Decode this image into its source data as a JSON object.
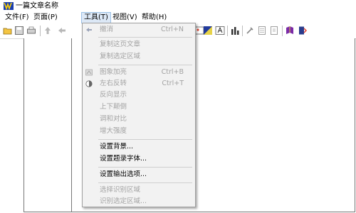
{
  "window": {
    "title": "一篇文章名称"
  },
  "menubar": {
    "items": [
      {
        "label": "文件(F)"
      },
      {
        "label": "页面(P)"
      },
      {
        "label": "工具(T)"
      },
      {
        "label": "视图(V)"
      },
      {
        "label": "帮助(H)"
      }
    ],
    "active": "工具(T)"
  },
  "toolbar": {
    "icons": [
      "open-folder-icon",
      "save-icon",
      "print-icon",
      "up-arrow-icon",
      "back-arrow-icon",
      "gallery-icon",
      "flag-icon",
      "text-box-icon",
      "chart-icon",
      "tools-icon",
      "page-icon",
      "copy-page-icon",
      "book-icon",
      "exit-door-icon"
    ]
  },
  "tools_menu": {
    "items": [
      {
        "label": "撤消",
        "shortcut": "Ctrl+N",
        "disabled": true,
        "icon": "undo-arrow-icon"
      },
      {
        "label": "复制这页文章",
        "shortcut": "",
        "disabled": true
      },
      {
        "label": "复制选定区域",
        "shortcut": "",
        "disabled": true
      },
      {
        "label": "图象加亮",
        "shortcut": "Ctrl+B",
        "disabled": true,
        "icon": "brighten-icon"
      },
      {
        "label": "左右反转",
        "shortcut": "Ctrl+T",
        "disabled": true,
        "icon": "contrast-icon"
      },
      {
        "label": "反向显示",
        "shortcut": "",
        "disabled": true
      },
      {
        "label": "上下颠倒",
        "shortcut": "",
        "disabled": true
      },
      {
        "label": "调和对比",
        "shortcut": "",
        "disabled": true
      },
      {
        "label": "增大强度",
        "shortcut": "",
        "disabled": true
      },
      {
        "label": "设置背景...",
        "shortcut": "",
        "disabled": false
      },
      {
        "label": "设置题录字体...",
        "shortcut": "",
        "disabled": false
      },
      {
        "label": "设置输出选项...",
        "shortcut": "",
        "disabled": false
      },
      {
        "label": "选择识别区域",
        "shortcut": "",
        "disabled": true
      },
      {
        "label": "识别选定区域...",
        "shortcut": "",
        "disabled": true
      }
    ]
  }
}
